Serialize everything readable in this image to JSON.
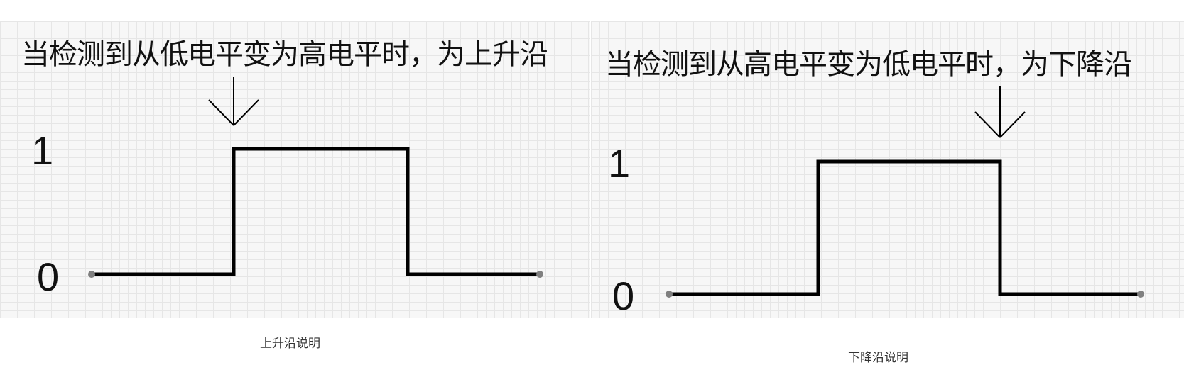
{
  "left_panel": {
    "heading": "当检测到从低电平变为高电平时，为上升沿",
    "level_high": "1",
    "level_low": "0",
    "caption": "上升沿说明"
  },
  "right_panel": {
    "heading": "当检测到从高电平变为低电平时，为下降沿",
    "level_high": "1",
    "level_low": "0",
    "caption": "下降沿说明"
  },
  "colors": {
    "line": "#000000",
    "endpoint": "#808080",
    "grid": "#e6e6e6",
    "background": "#f7f7f7"
  },
  "icons": [
    "down-arrow-icon"
  ]
}
